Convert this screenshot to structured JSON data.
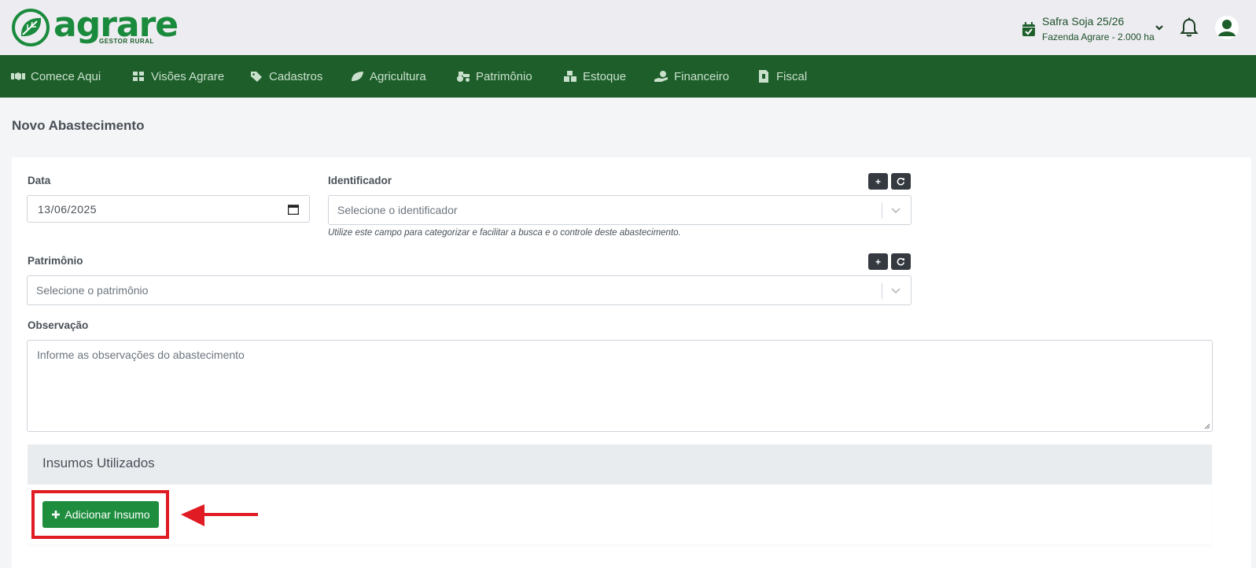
{
  "brand": {
    "name": "agrare",
    "subtitle": "GESTOR RURAL"
  },
  "header": {
    "safra_title": "Safra Soja 25/26",
    "safra_subtitle": "Fazenda Agrare - 2.000 ha",
    "icons": [
      "calendar-check-icon",
      "chevron-down-icon",
      "bell-icon",
      "user-icon"
    ]
  },
  "nav": {
    "items": [
      {
        "label": "Comece Aqui",
        "icon": "handshake-icon"
      },
      {
        "label": "Visões Agrare",
        "icon": "dashboard-icon"
      },
      {
        "label": "Cadastros",
        "icon": "tags-icon"
      },
      {
        "label": "Agricultura",
        "icon": "leaf-icon"
      },
      {
        "label": "Patrimônio",
        "icon": "tractor-icon"
      },
      {
        "label": "Estoque",
        "icon": "boxes-icon"
      },
      {
        "label": "Financeiro",
        "icon": "hand-dollar-icon"
      },
      {
        "label": "Fiscal",
        "icon": "invoice-icon"
      }
    ]
  },
  "page": {
    "title": "Novo Abastecimento"
  },
  "form": {
    "data": {
      "label": "Data",
      "value": "13/06/2025"
    },
    "identificador": {
      "label": "Identificador",
      "placeholder": "Selecione o identificador",
      "hint": "Utilize este campo para categorizar e facilitar a busca e o controle deste abastecimento.",
      "add_label": "+"
    },
    "patrimonio": {
      "label": "Patrimônio",
      "placeholder": "Selecione o patrimônio",
      "add_label": "+"
    },
    "observacao": {
      "label": "Observação",
      "placeholder": "Informe as observações do abastecimento"
    }
  },
  "insumos": {
    "title": "Insumos Utilizados",
    "add_button": "Adicionar Insumo"
  },
  "colors": {
    "brand_green": "#1a8a3c",
    "nav_green": "#1d5e2a",
    "button_green": "#1e8e3e",
    "annotation_red": "#e01b24"
  }
}
